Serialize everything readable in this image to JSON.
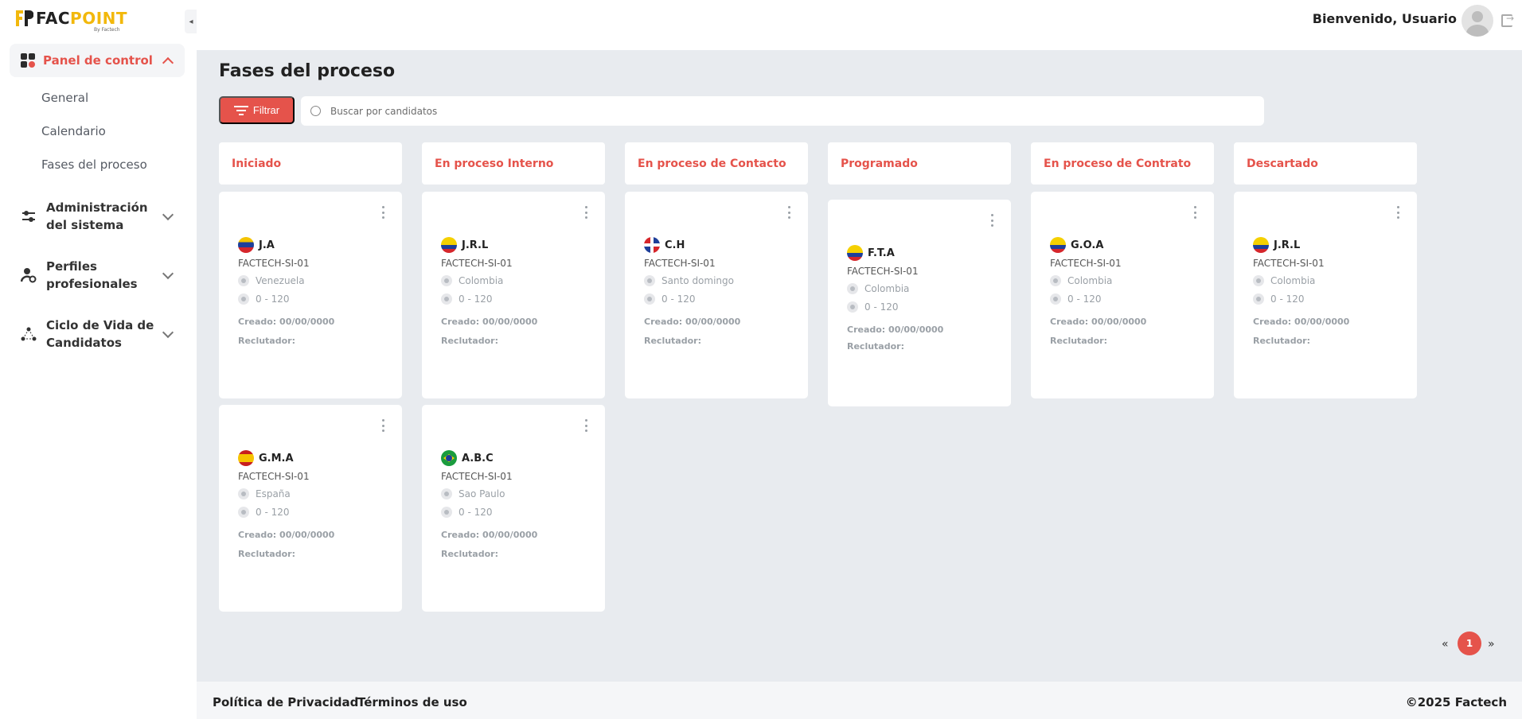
{
  "brand": {
    "logo_pre": "FAC",
    "logo_post": "POINT",
    "logo_sub": "By Factech"
  },
  "sidebar": {
    "active_item": {
      "label": "Panel de control",
      "icon": "dashboard-grid-icon"
    },
    "subitems": [
      {
        "label": "General"
      },
      {
        "label": "Calendario"
      },
      {
        "label": "Fases del proceso"
      }
    ],
    "groups": [
      {
        "label": "Administración del sistema",
        "icon": "sliders-icon"
      },
      {
        "label": "Perfiles profesionales",
        "icon": "user-settings-icon"
      },
      {
        "label": "Ciclo de Vida de Candidatos",
        "icon": "network-icon"
      }
    ]
  },
  "header": {
    "welcome": "Bienvenido, Usuario"
  },
  "main": {
    "title": "Fases del proceso",
    "filter_label": "Filtrar",
    "search_placeholder": "Buscar por candidatos",
    "columns": [
      {
        "title": "Iniciado"
      },
      {
        "title": "En proceso Interno"
      },
      {
        "title": "En proceso de Contacto"
      },
      {
        "title": "Programado"
      },
      {
        "title": "En proceso de Contrato"
      },
      {
        "title": "Descartado"
      }
    ],
    "cards": [
      {
        "name": "J.A",
        "code": "FACTECH-SI-01",
        "location": "Venezuela",
        "range": "0 - 120",
        "created": "Creado: 00/00/0000",
        "recruiter": "Reclutador:",
        "flag": "venezuela"
      },
      {
        "name": "G.M.A",
        "code": "FACTECH-SI-01",
        "location": "España",
        "range": "0 - 120",
        "created": "Creado: 00/00/0000",
        "recruiter": "Reclutador:",
        "flag": "spain"
      },
      {
        "name": "J.R.L",
        "code": "FACTECH-SI-01",
        "location": "Colombia",
        "range": "0 - 120",
        "created": "Creado: 00/00/0000",
        "recruiter": "Reclutador:",
        "flag": "colombia"
      },
      {
        "name": "A.B.C",
        "code": "FACTECH-SI-01",
        "location": "Sao Paulo",
        "range": "0 - 120",
        "created": "Creado: 00/00/0000",
        "recruiter": "Reclutador:",
        "flag": "brazil"
      },
      {
        "name": "C.H",
        "code": "FACTECH-SI-01",
        "location": "Santo domingo",
        "range": "0 - 120",
        "created": "Creado: 00/00/0000",
        "recruiter": "Reclutador:",
        "flag": "dominican-republic"
      },
      {
        "name": "F.T.A",
        "code": "FACTECH-SI-01",
        "location": "Colombia",
        "range": "0 - 120",
        "created": "Creado: 00/00/0000",
        "recruiter": "Reclutador:",
        "flag": "colombia"
      },
      {
        "name": "G.O.A",
        "code": "FACTECH-SI-01",
        "location": "Colombia",
        "range": "0 - 120",
        "created": "Creado: 00/00/0000",
        "recruiter": "Reclutador:",
        "flag": "colombia"
      },
      {
        "name": "J.R.L",
        "code": "FACTECH-SI-01",
        "location": "Colombia",
        "range": "0 - 120",
        "created": "Creado: 00/00/0000",
        "recruiter": "Reclutador:",
        "flag": "colombia"
      }
    ]
  },
  "pagination": {
    "prev": "«",
    "current": "1",
    "next": "»"
  },
  "footer": {
    "privacy": "Política de Privacidad",
    "terms": "Términos de uso",
    "copyright": "©2025 Factech"
  },
  "colors": {
    "accent": "#e5534b",
    "brand_yellow": "#f2b80c"
  }
}
